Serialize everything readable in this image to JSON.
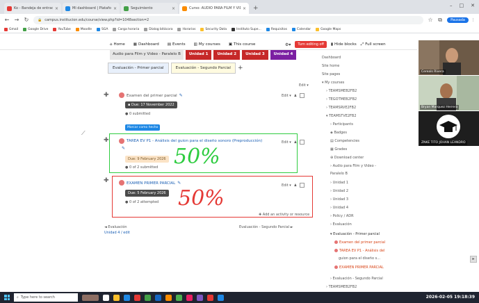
{
  "browser": {
    "tabs": [
      {
        "title": "Ko - Bandeja de entrada",
        "color": "#e53935"
      },
      {
        "title": "Mi dashboard | Plataforma",
        "color": "#1e88e5"
      },
      {
        "title": "Seguimiento",
        "color": "#43a047"
      },
      {
        "title": "Curso: AUDIO PARA FILM Y VIDEO",
        "color": "#fb8c00",
        "active": true
      }
    ],
    "new_tab": "+",
    "url": "campus.institucion.edu/course/view.php?id=1048section=2",
    "profile_label": "Pausada",
    "bookmarks": [
      {
        "label": "Gmail",
        "color": "#e53935"
      },
      {
        "label": "Google Drive",
        "color": "#43a047"
      },
      {
        "label": "YouTube",
        "color": "#e53935"
      },
      {
        "label": "Moodle",
        "color": "#fb8c00"
      },
      {
        "label": "SGA",
        "color": "#1e88e5"
      },
      {
        "label": "Carga horaria",
        "color": "#9e9e9e"
      },
      {
        "label": "Dialog bitácora",
        "color": "#9e9e9e"
      },
      {
        "label": "Horarios",
        "color": "#9e9e9e"
      },
      {
        "label": "Security Data",
        "color": "#fbc02d"
      },
      {
        "label": "Instituto Supe...",
        "color": "#333333"
      },
      {
        "label": "Requisitos",
        "color": "#1e88e5"
      },
      {
        "label": "Calendar",
        "color": "#1e88e5"
      },
      {
        "label": "Google Maps",
        "color": "#fbc02d"
      }
    ]
  },
  "navbar": {
    "items": [
      "Home",
      "Dashboard",
      "Events",
      "My courses",
      "This course"
    ],
    "edit_mode": "Turn editing off",
    "hide_blocks": "Hide blocks",
    "fullscreen": "Full screen"
  },
  "course": {
    "section_title": "Audio para Film y Video - Paralelo B",
    "units": [
      "Unidad 1",
      "Unidad 2",
      "Unidad 3",
      "Unidad 4"
    ],
    "eval_tabs": [
      "Evaluación - Primer parcial",
      "Evaluación - Segundo Parcial"
    ],
    "add_tab": "+",
    "edit_label": "Edit",
    "activities": [
      {
        "name": "Examen del primer parcial",
        "date": "Due: 17 November 2022",
        "status": "0 submitted",
        "button": "Marcar como hecho"
      },
      {
        "name": "TAREA EV P1 - Análisis del guion para el diseño sonoro (Preproducción)",
        "date": "Due: 9 February 2026",
        "status": "0 of 2 submitted",
        "annotation": "50%"
      },
      {
        "name": "EXAMEN PRIMER PARCIAL",
        "date": "Due: 5 February 2026",
        "status": "0 of 2 attempted",
        "annotation": "50%"
      }
    ],
    "add_activity": "Add an activity or resource",
    "prev_section": "◄ Evaluación",
    "prev_section_sub": "Unidad 4 / edit",
    "next_section": "Evaluación - Segundo Parcial ►"
  },
  "index": [
    {
      "label": "Dashboard",
      "indent": 0
    },
    {
      "label": "Site home",
      "indent": 0
    },
    {
      "label": "Site pages",
      "indent": 0
    },
    {
      "label": "My courses",
      "indent": 0
    },
    {
      "label": "TEAMSMEB2FB2",
      "indent": 1
    },
    {
      "label": "TEGOTMEB2FB2",
      "indent": 1
    },
    {
      "label": "TEAMSRVE2FB2",
      "indent": 1
    },
    {
      "label": "TEAMSTVE2FB2",
      "indent": 1
    },
    {
      "label": "Participants",
      "indent": 2
    },
    {
      "label": "Badges",
      "indent": 2
    },
    {
      "label": "Competencies",
      "indent": 2
    },
    {
      "label": "Grades",
      "indent": 2
    },
    {
      "label": "Download center",
      "indent": 2
    },
    {
      "label": "Audio para Film y Video -",
      "indent": 2
    },
    {
      "label": "Paralelo B",
      "indent": 2
    },
    {
      "label": "Unidad 1",
      "indent": 2
    },
    {
      "label": "Unidad 2",
      "indent": 2
    },
    {
      "label": "Unidad 3",
      "indent": 2
    },
    {
      "label": "Unidad 4",
      "indent": 2
    },
    {
      "label": "Policy / ADR",
      "indent": 2
    },
    {
      "label": "Evaluación",
      "indent": 2
    },
    {
      "label": "Evaluación - Primer parcial",
      "indent": 2
    },
    {
      "label": "Examen del primer parcial",
      "indent": 3,
      "red": true
    },
    {
      "label": "TAREA EV P1 - Análisis del",
      "indent": 3,
      "red": true
    },
    {
      "label": "guion para el diseño s...",
      "indent": 3
    },
    {
      "label": "EXAMEN PRIMER PARCIAL",
      "indent": 3,
      "red": true
    },
    {
      "label": "Evaluación - Segundo Parcial",
      "indent": 2
    },
    {
      "label": "TEAMSMEB2FB2",
      "indent": 1
    }
  ],
  "videos": [
    {
      "name": "Cereals Rivera"
    },
    {
      "name": "Bryan Marquez Herrera"
    },
    {
      "name": "ZNKE TITO JOHAN LEANDRO"
    }
  ],
  "taskbar": {
    "search": "Type here to search",
    "clock": "2026-02-05 19:18:39"
  }
}
